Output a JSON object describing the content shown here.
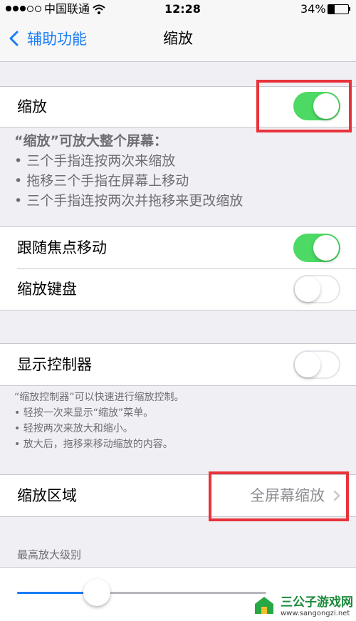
{
  "status_bar": {
    "carrier": "中国联通",
    "time": "12:28",
    "battery": "34%",
    "wifi_icon": "wifi-icon",
    "battery_icon": "battery-icon"
  },
  "nav": {
    "back_label": "辅助功能",
    "title": "缩放"
  },
  "zoom": {
    "label": "缩放",
    "enabled": true,
    "footer_title": "“缩放”可放大整个屏幕：",
    "footer_items": [
      "• 三个手指连按两次来缩放",
      "• 拖移三个手指在屏幕上移动",
      "• 三个手指连按两次并拖移来更改缩放"
    ]
  },
  "follow_focus": {
    "label": "跟随焦点移动",
    "enabled": true
  },
  "zoom_keyboard": {
    "label": "缩放键盘",
    "enabled": false
  },
  "controller": {
    "label": "显示控制器",
    "enabled": false,
    "footer_title": "“缩放控制器”可以快速进行缩放控制。",
    "footer_items": [
      "• 轻按一次来显示“缩放”菜单。",
      "• 轻按两次来放大和缩小。",
      "• 放大后，拖移来移动缩放的内容。"
    ]
  },
  "zoom_region": {
    "label": "缩放区域",
    "value": "全屏幕缩放"
  },
  "max_zoom": {
    "header": "最高放大级别",
    "level_fraction": 0.32
  },
  "watermark": {
    "title": "三公子游戏网",
    "url": "www.sangongzi.net"
  },
  "colors": {
    "accent": "#1a7cf5",
    "switch_on": "#4cd964",
    "highlight": "#e8333a"
  }
}
